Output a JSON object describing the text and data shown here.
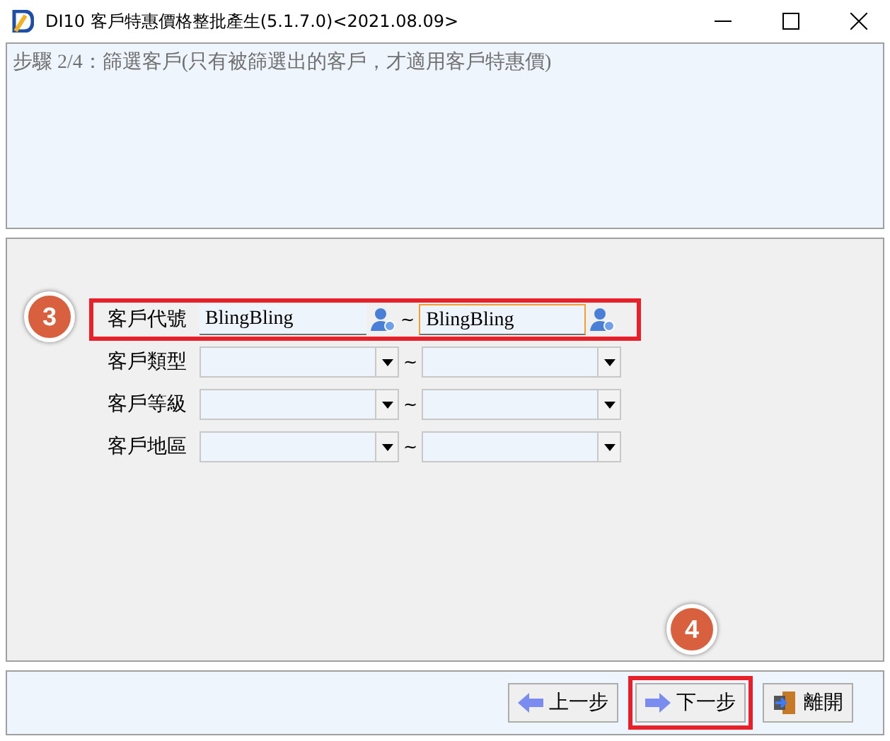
{
  "window": {
    "title": "DI10 客戶特惠價格整批產生(5.1.7.0)<2021.08.09>"
  },
  "step": "步驟 2/4：篩選客戶(只有被篩選出的客戶，才適用客戶特惠價)",
  "filters": [
    {
      "kind": "text",
      "label": "客戶代號",
      "from": "BlingBling",
      "separator": "~",
      "to": "BlingBling",
      "highlighted": true,
      "callout": "3"
    },
    {
      "kind": "combo",
      "label": "客戶類型",
      "separator": "~",
      "highlighted": false
    },
    {
      "kind": "combo",
      "label": "客戶等級",
      "separator": "~",
      "highlighted": false
    },
    {
      "kind": "combo",
      "label": "客戶地區",
      "separator": "~",
      "highlighted": false
    }
  ],
  "buttons": [
    {
      "kind": "back",
      "label": "上一步",
      "highlighted": false
    },
    {
      "kind": "next",
      "label": "下一步",
      "highlighted": true,
      "callout": "4"
    },
    {
      "kind": "exit",
      "label": "離開",
      "highlighted": false
    }
  ]
}
